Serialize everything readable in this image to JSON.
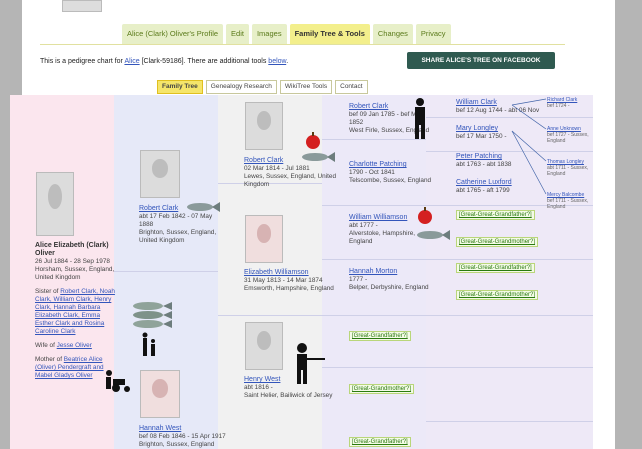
{
  "tabs": [
    {
      "label": "Alice (Clark) Oliver's Profile",
      "active": false
    },
    {
      "label": "Edit",
      "active": false
    },
    {
      "label": "Images",
      "active": false
    },
    {
      "label": "Family Tree & Tools",
      "active": true
    },
    {
      "label": "Changes",
      "active": false
    },
    {
      "label": "Privacy",
      "active": false
    }
  ],
  "intro": {
    "pre": "This is a pedigree chart for ",
    "link": "Alice",
    "mid": " [Clark-59186]. There are additional tools ",
    "link2": "below",
    "post": "."
  },
  "fb_button": "SHARE ALICE'S TREE ON FACEBOOK",
  "subtabs": [
    {
      "label": "Family Tree",
      "active": true
    },
    {
      "label": "Genealogy Research",
      "active": false
    },
    {
      "label": "WikiTree Tools",
      "active": false
    },
    {
      "label": "Contact",
      "active": false
    }
  ],
  "subject": {
    "name": "Alice Elizabeth (Clark) Oliver",
    "dates": "26 Jul 1884 - 28 Sep 1978",
    "place": "Horsham, Sussex, England, United Kingdom",
    "sister_label": "Sister of",
    "siblings_text": "Robert Clark, Noah Clark, William Clark, Henry Clark, Hannah Barbara Elizabeth Clark, Emma Esther Clark and Rosina Caroline Clark",
    "wife_label": "Wife of",
    "spouse": "Jesse Oliver",
    "mother_label": "Mother of",
    "children_text": "Beatrice Alice (Oliver) Pendergraft and Mabel Gladys Oliver"
  },
  "parents": [
    {
      "name": "Robert Clark",
      "dates": "abt 17 Feb 1842 - 07 May 1888",
      "place": "Brighton, Sussex, England, United Kingdom"
    },
    {
      "name": "Hannah West",
      "dates": "bef 08 Feb 1846 - 15 Apr 1917",
      "place": "Brighton, Sussex, England"
    }
  ],
  "grandparents": [
    {
      "name": "Robert Clark",
      "dates": "02 Mar 1814 - Jul 1881",
      "place": "Lewes, Sussex, England, United Kingdom"
    },
    {
      "name": "Elizabeth Williamson",
      "dates": "31 May 1813 - 14 Mar 1874",
      "place": "Emsworth, Hampshire, England"
    },
    {
      "name": "Henry West",
      "dates": "abt 1816 -",
      "place": "Saint Helier, Bailiwick of Jersey"
    }
  ],
  "greatgrandparents": [
    {
      "name": "Robert Clark",
      "dates": "bef 09 Jan 1785 - bef Mar 1852",
      "place": "West Firle, Sussex, England"
    },
    {
      "name": "Charlotte Patching",
      "dates": "1790 - Oct 1841",
      "place": "Telscombe, Sussex, England"
    },
    {
      "name": "William Williamson",
      "dates": "abt 1777 -",
      "place": "Alverstoke, Hampshire, England"
    },
    {
      "name": "Hannah Morton",
      "dates": "1777 -",
      "place": "Belper, Derbyshire, England"
    }
  ],
  "placeholders": {
    "gf": "[Great-Grandfather?]",
    "gm": "[Great-Grandmother?]",
    "ggf": "[Great-Great-Grandfather?]",
    "ggm": "[Great-Great-Grandmother?]"
  },
  "gg": [
    {
      "name": "William Clark",
      "dates": "bef 12 Aug 1744 - abt 06 Nov",
      "place": ""
    },
    {
      "name": "Mary Longley",
      "dates": "bef 17 Mar 1750 -",
      "place": ""
    },
    {
      "name": "Peter Patching",
      "dates": "abt 1763 - abt 1838",
      "place": ""
    },
    {
      "name": "Catherine Luxford",
      "dates": "abt 1765 - aft 1799",
      "place": ""
    }
  ],
  "ggg": [
    {
      "name": "Richard Clark",
      "dates": "bef 1724 -"
    },
    {
      "name": "Anne Unknown",
      "dates": "bef 1727 - Sussex, England"
    },
    {
      "name": "Thomas Longley",
      "dates": "abt 1711 - Sussex, England"
    },
    {
      "name": "Mercy Balcombe",
      "dates": "bef 1711 - Sussex, England"
    }
  ]
}
